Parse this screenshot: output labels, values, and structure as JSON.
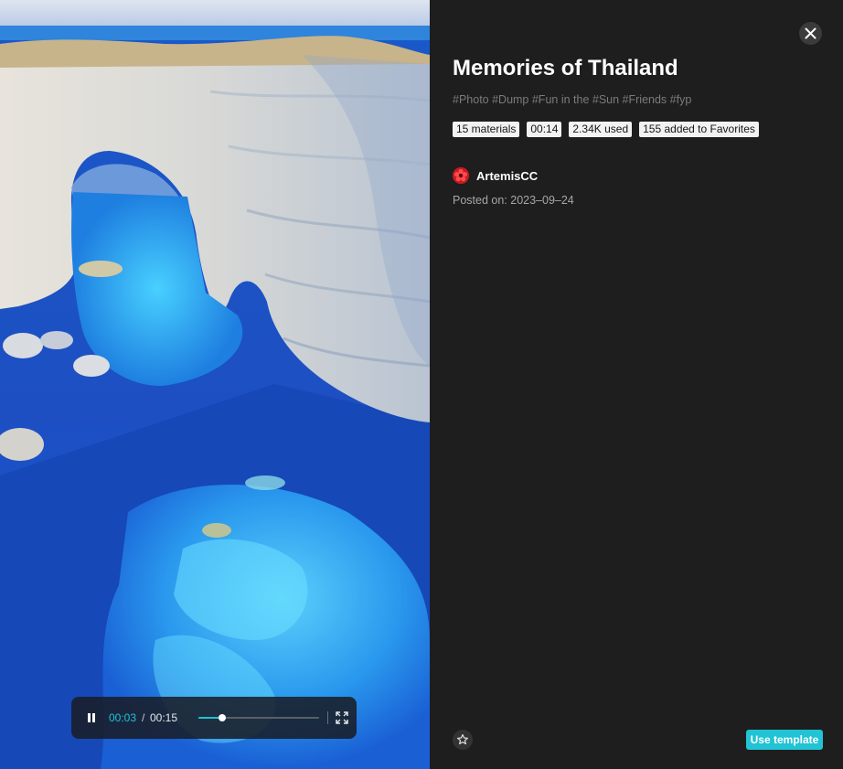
{
  "colors": {
    "accent": "#21c3d4",
    "panel_background": "#1e1e1e",
    "badge_background": "#f2f2f2",
    "avatar": "#d51f2a"
  },
  "template": {
    "title": "Memories of Thailand",
    "tags": "#Photo #Dump #Fun in the #Sun #Friends #fyp",
    "badges": [
      "15 materials",
      "00:14",
      "2.34K used",
      "155 added to Favorites"
    ],
    "author": {
      "name": "ArtemisCC",
      "avatar_icon": "red-flower-avatar"
    },
    "posted": "Posted on: 2023–09–24"
  },
  "player": {
    "current_time": "00:03",
    "separator": "/",
    "duration": "00:15",
    "progress_fraction": 0.2,
    "state": "playing",
    "icons": {
      "pause": "pause-icon",
      "fullscreen": "fullscreen-icon"
    }
  },
  "actions": {
    "use_template_label": "Use template",
    "favorite_icon": "star-icon",
    "close_icon": "close-icon"
  }
}
